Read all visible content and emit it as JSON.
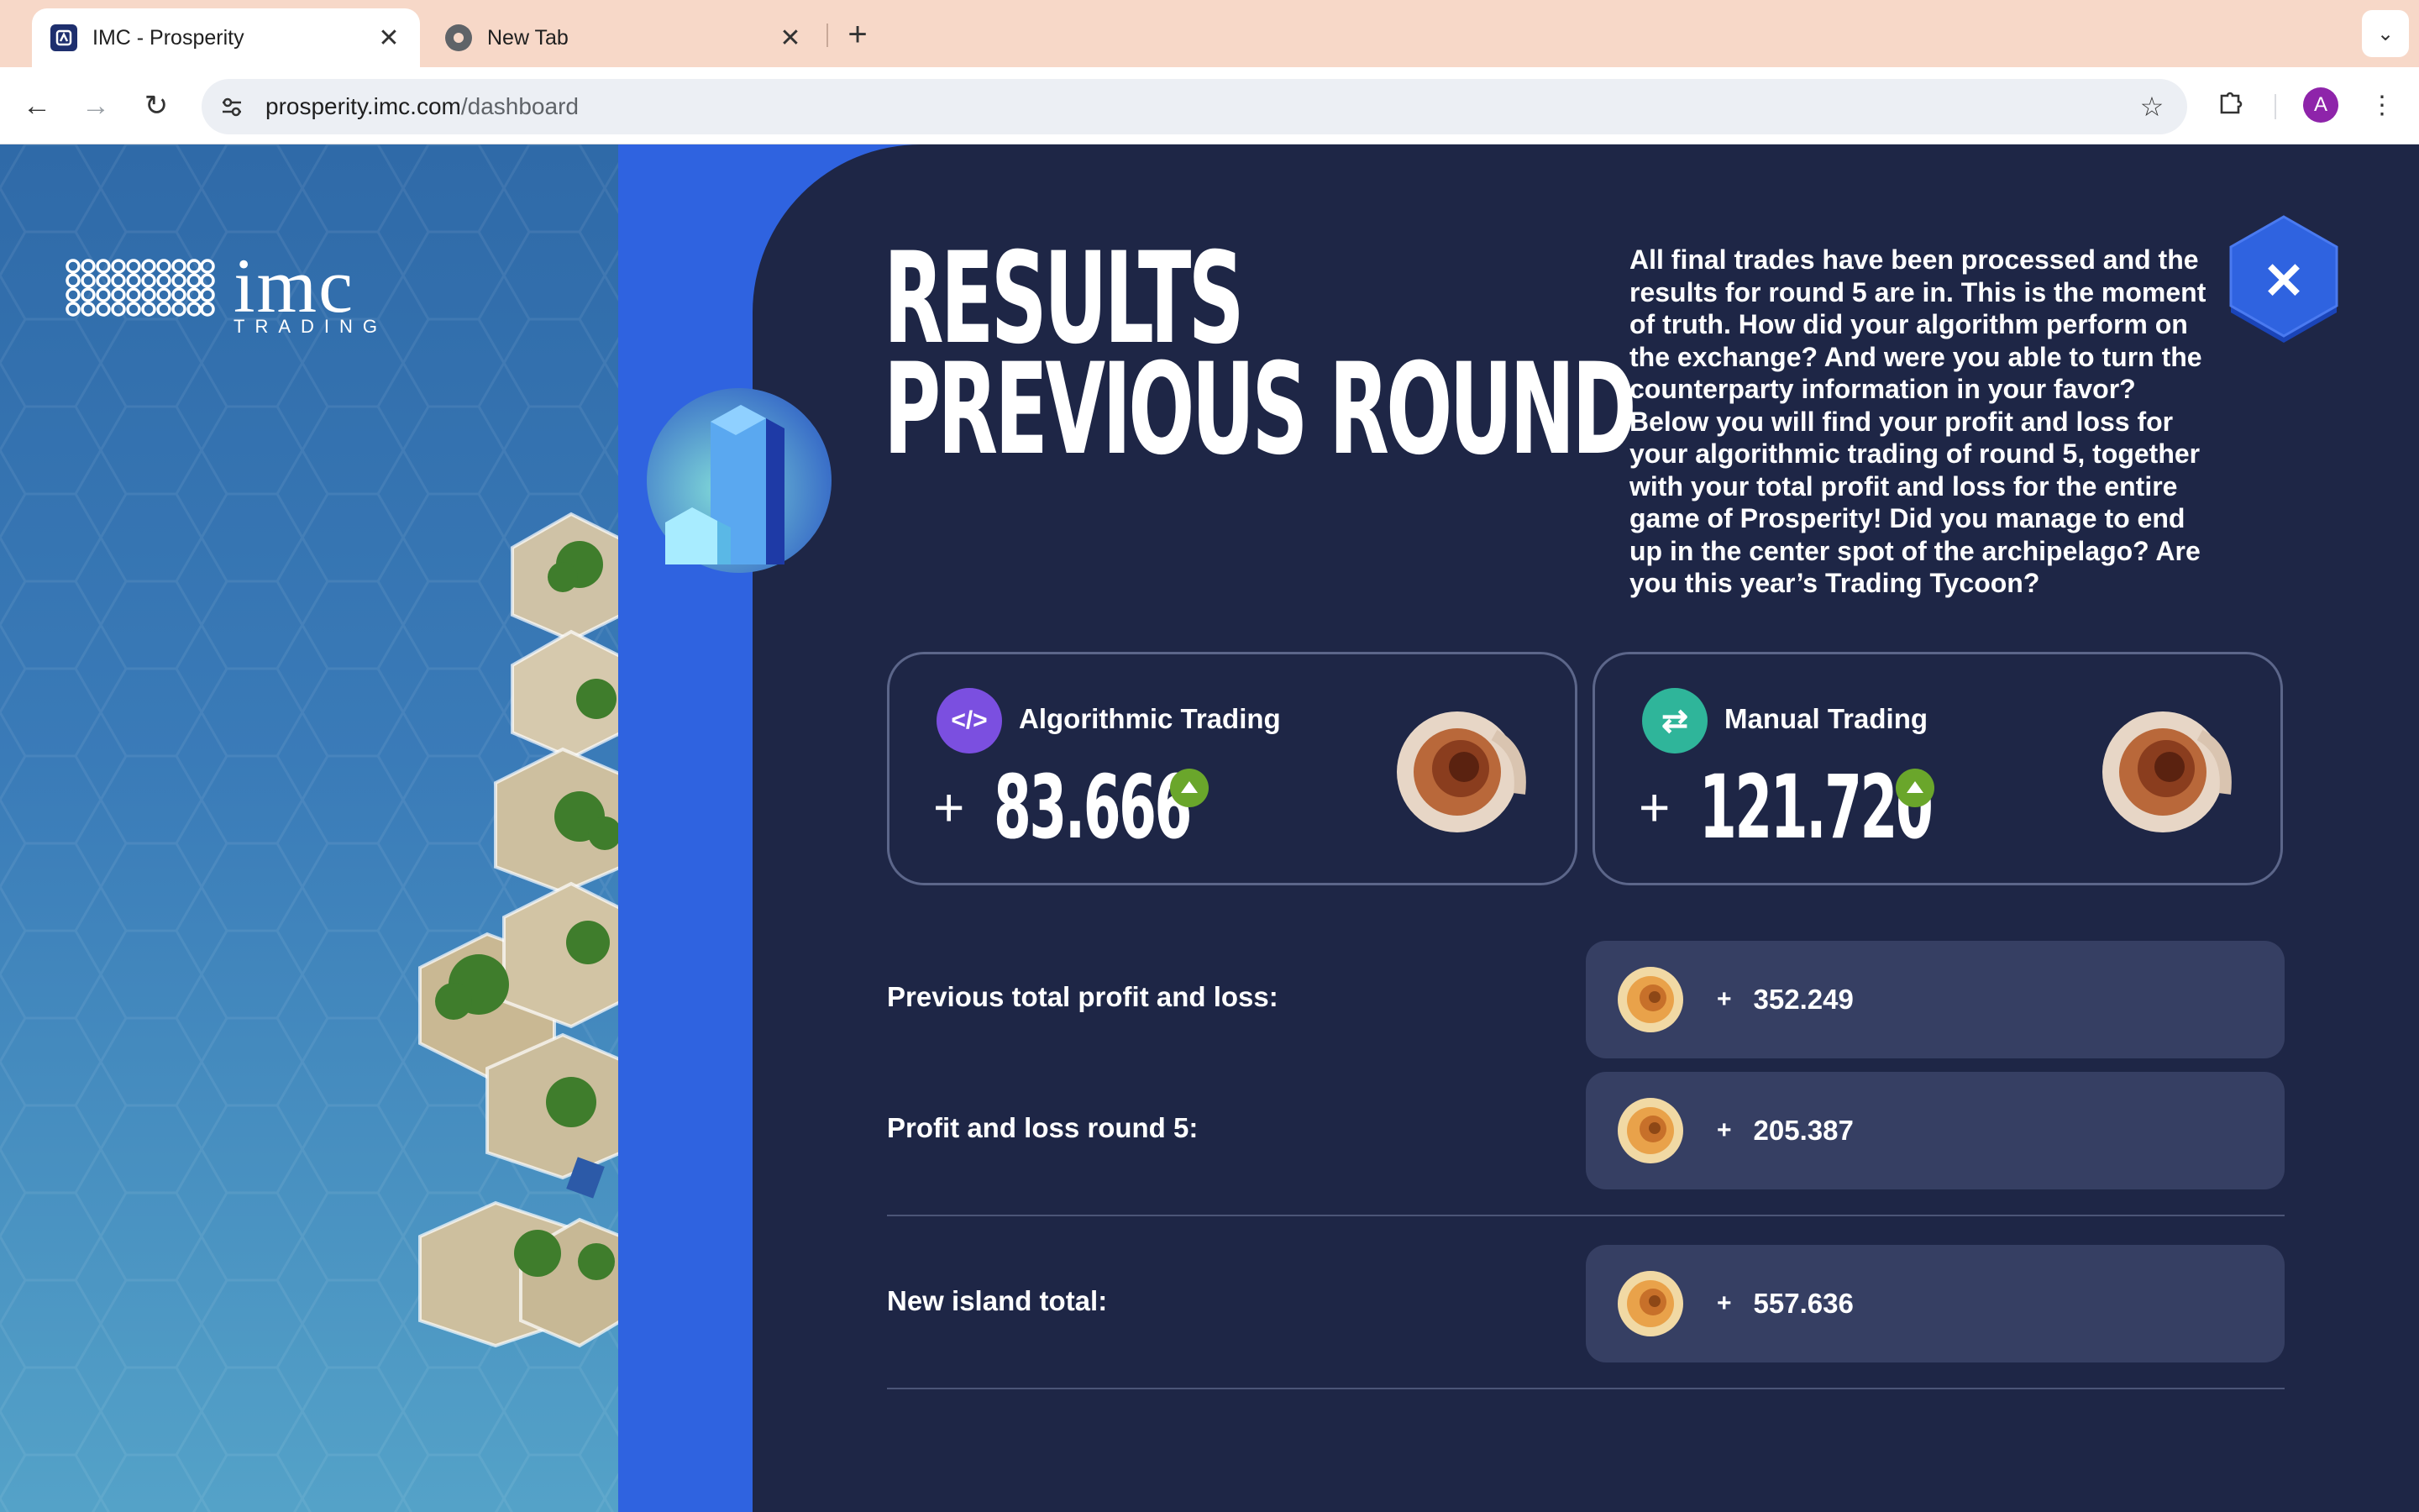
{
  "browser": {
    "tabs": [
      {
        "title": "IMC - Prosperity",
        "active": true
      },
      {
        "title": "New Tab",
        "active": false
      }
    ],
    "url_host": "prosperity.imc.com",
    "url_path": "/dashboard",
    "profile_initial": "A"
  },
  "logo": {
    "name": "imc",
    "tagline": "TRADING"
  },
  "heading": {
    "line1": "RESULTS",
    "line2": "PREVIOUS ROUND"
  },
  "intro": "All final trades have been processed and the results for round 5 are in. This is the moment of truth. How did your algorithm perform on the exchange? And were you able to turn the counterparty information in your favor? Below you will find your profit and loss for your algorithmic trading of round 5, together with your total profit and loss for the entire game of Prosperity! Did you manage to end up in the center spot of the archipelago? Are you this year’s Trading Tycoon?",
  "cards": {
    "algo": {
      "label": "Algorithmic Trading",
      "sign": "+",
      "value": "83.666",
      "icon": "code-icon",
      "trend": "up"
    },
    "manual": {
      "label": "Manual Trading",
      "sign": "+",
      "value": "121.720",
      "icon": "swap-arrows-icon",
      "trend": "up"
    }
  },
  "summary": [
    {
      "label": "Previous total profit and loss:",
      "sign": "+",
      "value": "352.249"
    },
    {
      "label": "Profit and loss round 5:",
      "sign": "+",
      "value": "205.387"
    },
    {
      "label": "New island total:",
      "sign": "+",
      "value": "557.636"
    }
  ],
  "colors": {
    "panel": "#1e2646",
    "accent_blue": "#2f63e0",
    "pill": "#363f63",
    "algo_badge": "#7b4fe0",
    "manual_badge": "#2fb59a",
    "trend_up": "#6aa62b"
  }
}
